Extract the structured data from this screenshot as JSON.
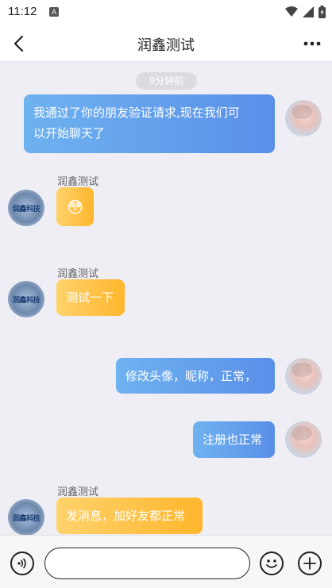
{
  "status": {
    "time": "11:12",
    "notif_letter": "A"
  },
  "header": {
    "title": "润鑫测试",
    "back_icon": "chevron-left-icon",
    "more_icon": "more-horizontal-icon"
  },
  "chat": {
    "timestamp": "9分钟前",
    "messages": [
      {
        "side": "me",
        "text_line1": "我通过了你的朋友验证请求,现在我们可",
        "text_line2": "以开始聊天了"
      },
      {
        "side": "other",
        "sender": "润鑫测试",
        "emoji": "😳"
      },
      {
        "side": "other",
        "sender": "润鑫测试",
        "text": "测试一下"
      },
      {
        "side": "me",
        "text": "修改头像，昵称，正常，"
      },
      {
        "side": "me",
        "text": "注册也正常"
      },
      {
        "side": "other",
        "sender": "润鑫测试",
        "text": "发消息，加好友都正常"
      }
    ],
    "other_avatar_text": "润鑫科技"
  },
  "input": {
    "placeholder": ""
  },
  "colors": {
    "me_bubble": "#5a8fe8",
    "other_bubble": "#ffb62d",
    "background": "#efeef4"
  }
}
